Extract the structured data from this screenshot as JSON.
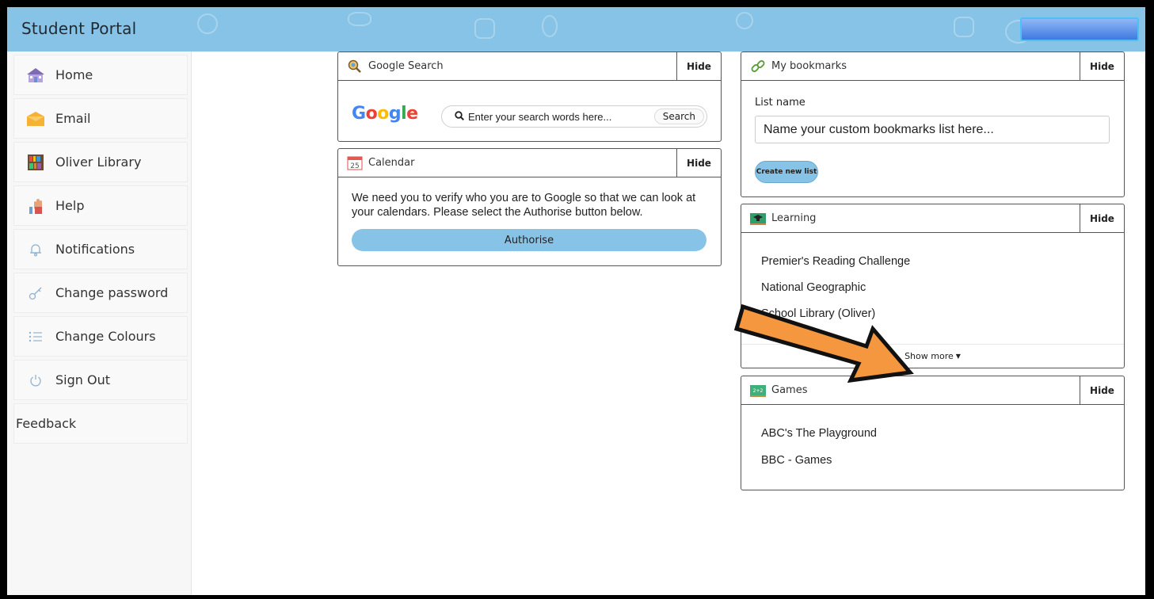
{
  "header": {
    "title": "Student Portal"
  },
  "sidebar": {
    "items": [
      {
        "label": "Home",
        "icon": "home-icon"
      },
      {
        "label": "Email",
        "icon": "email-icon"
      },
      {
        "label": "Oliver Library",
        "icon": "library-icon"
      },
      {
        "label": "Help",
        "icon": "help-hand-icon"
      },
      {
        "label": "Notifications",
        "icon": "bell-icon"
      },
      {
        "label": "Change password",
        "icon": "key-icon"
      },
      {
        "label": "Change Colours",
        "icon": "list-icon"
      },
      {
        "label": "Sign Out",
        "icon": "power-icon"
      },
      {
        "label": "Feedback"
      }
    ]
  },
  "widgets": {
    "google_search": {
      "title": "Google Search",
      "hide_label": "Hide",
      "logo_text": "Google",
      "search_placeholder": "Enter your search words here...",
      "search_button": "Search"
    },
    "calendar": {
      "title": "Calendar",
      "hide_label": "Hide",
      "icon_text": "25",
      "message": "We need you to verify who you are to Google so that we can look at your calendars. Please select the Authorise button below.",
      "authorise_label": "Authorise"
    },
    "bookmarks": {
      "title": "My bookmarks",
      "hide_label": "Hide",
      "list_name_label": "List name",
      "list_name_placeholder": "Name your custom bookmarks list here...",
      "create_button": "Create new list"
    },
    "learning": {
      "title": "Learning",
      "hide_label": "Hide",
      "items": [
        "Premier's Reading Challenge",
        "National Geographic",
        "School Library (Oliver)"
      ],
      "show_more_label": "Show more"
    },
    "games": {
      "title": "Games",
      "hide_label": "Hide",
      "icon_text": "2+2",
      "items": [
        "ABC's The Playground",
        "BBC - Games"
      ]
    }
  },
  "colors": {
    "header_bg": "#87c3e6",
    "accent": "#87c3e6",
    "arrow_fill": "#f4973f"
  }
}
